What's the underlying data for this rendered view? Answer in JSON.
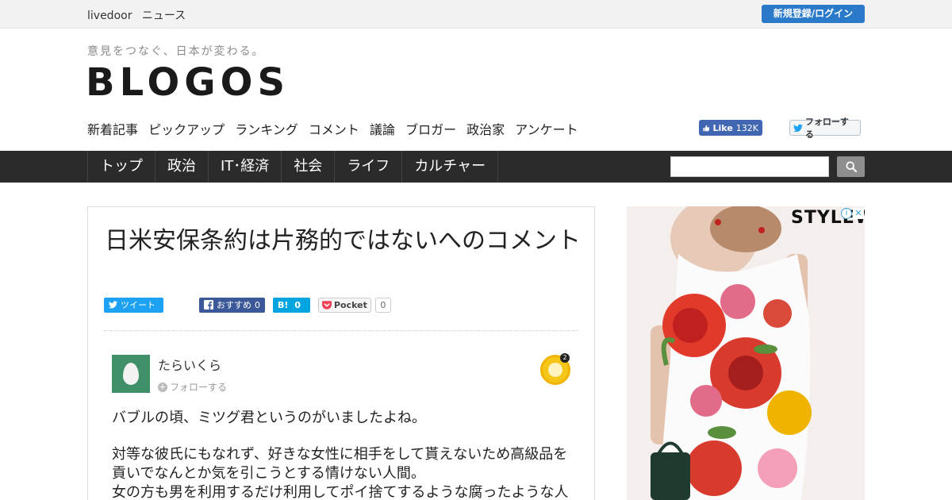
{
  "topbar": {
    "brand": "livedoor",
    "section": "ニュース",
    "login_label": "新規登録/ログイン"
  },
  "header": {
    "tagline": "意見をつなぐ、日本が変わる。",
    "logo": "BLOGOS",
    "subnav": [
      "新着記事",
      "ピックアップ",
      "ランキング",
      "コメント",
      "議論",
      "ブロガー",
      "政治家",
      "アンケート"
    ],
    "fb_like_label": "Like",
    "fb_like_count": "132K",
    "twitter_follow_label": "フォローする"
  },
  "catnav": {
    "items": [
      "トップ",
      "政治",
      "IT･経済",
      "社会",
      "ライフ",
      "カルチャー"
    ]
  },
  "search": {
    "placeholder": ""
  },
  "article": {
    "title": "日米安保条約は片務的ではないへのコメント",
    "share": {
      "tweet_label": "ツイート",
      "fb_label": "おすすめ",
      "fb_count": "0",
      "hatena_label": "B!",
      "hatena_count": "0",
      "pocket_label": "Pocket",
      "pocket_count": "0"
    },
    "comment": {
      "author": "たらいくら",
      "follow_label": "フォローする",
      "badge_count": "2",
      "paragraphs": [
        "バブルの頃、ミツグ君というのがいましたよね。",
        "対等な彼氏にもなれず、好きな女性に相手をして貰えないため高級品を貢いでなんとか気を引こうとする情けない人間。\n女の方も男を利用するだけ利用してポイ捨てするような腐ったような人"
      ]
    }
  },
  "ad": {
    "brand": "STYLEWE"
  },
  "colors": {
    "accent": "#2a7ac9",
    "nav_bg": "#2b2b2b",
    "facebook": "#3b5998",
    "twitter": "#1da1f2",
    "hatena": "#00a4de"
  }
}
